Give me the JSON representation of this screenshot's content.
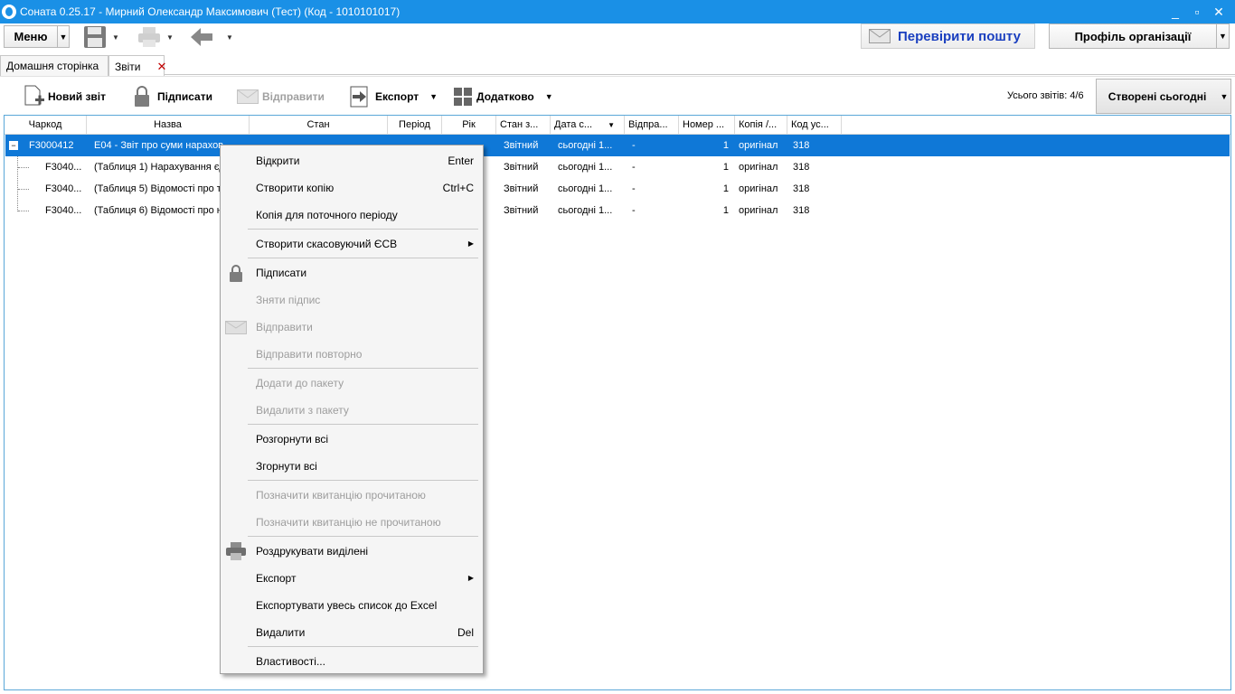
{
  "window": {
    "title": "Соната 0.25.17 - Мирний Олександр Максимович (Тест) (Код - 1010101017)",
    "controls": [
      "_",
      "▫",
      "✕"
    ]
  },
  "topbar": {
    "menu_label": "Меню",
    "check_mail_label": "Перевірити пошту",
    "profile_label": "Профіль організації"
  },
  "tabs": [
    {
      "label": "Домашня сторінка"
    },
    {
      "label": "Звіти",
      "close": "✕"
    }
  ],
  "toolbar": {
    "new_report": "Новий звіт",
    "sign": "Підписати",
    "send": "Відправити",
    "export": "Експорт",
    "more": "Додатково",
    "count_label": "Усього звітів: 4/6",
    "filter_label": "Створені сьогодні"
  },
  "grid": {
    "columns": [
      "Чаркод",
      "Назва",
      "Стан",
      "Період",
      "Рік",
      "Стан з...",
      "Дата с...",
      "Відпра...",
      "Номер ...",
      "Копія /...",
      "Код ус..."
    ],
    "rows": [
      {
        "code": "F3000412",
        "name": "Е04 - Звіт про суми нарахов",
        "status": "Звітний",
        "date": "сьогодні 1...",
        "sent": "-",
        "number": "1",
        "copy": "оригінал",
        "code_us": "318"
      },
      {
        "code": "F3040...",
        "name": "(Таблиця 1) Нарахування єд",
        "status": "Звітний",
        "date": "сьогодні 1...",
        "sent": "-",
        "number": "1",
        "copy": "оригінал",
        "code_us": "318"
      },
      {
        "code": "F3040...",
        "name": "(Таблиця 5) Відомості про тр",
        "status": "Звітний",
        "date": "сьогодні 1...",
        "sent": "-",
        "number": "1",
        "copy": "оригінал",
        "code_us": "318"
      },
      {
        "code": "F3040...",
        "name": "(Таблиця 6) Відомості про на",
        "status": "Звітний",
        "date": "сьогодні 1...",
        "sent": "-",
        "number": "1",
        "copy": "оригінал",
        "code_us": "318"
      }
    ]
  },
  "context_menu": {
    "items": [
      {
        "label": "Відкрити",
        "shortcut": "Enter"
      },
      {
        "label": "Створити копію",
        "shortcut": "Ctrl+C"
      },
      {
        "label": "Копія для поточного періоду"
      },
      {
        "label": "Створити скасовуючий ЄСВ",
        "submenu": "▶"
      },
      {
        "label": "Підписати"
      },
      {
        "label": "Зняти підпис"
      },
      {
        "label": "Відправити"
      },
      {
        "label": "Відправити повторно"
      },
      {
        "label": "Додати до пакету"
      },
      {
        "label": "Видалити з пакету"
      },
      {
        "label": "Розгорнути всі"
      },
      {
        "label": "Згорнути всі"
      },
      {
        "label": "Позначити квитанцію прочитаною"
      },
      {
        "label": "Позначити квитанцію не прочитаною"
      },
      {
        "label": "Роздрукувати виділені"
      },
      {
        "label": "Експорт",
        "submenu": "▶"
      },
      {
        "label": "Експортувати увесь список до Excel"
      },
      {
        "label": "Видалити",
        "shortcut": "Del"
      },
      {
        "label": "Властивості..."
      }
    ]
  },
  "colors": {
    "titlebar": "#1a90e6",
    "selection": "#0f78d7",
    "mail_text": "#1a3fbf",
    "close_tab": "#c00000"
  }
}
